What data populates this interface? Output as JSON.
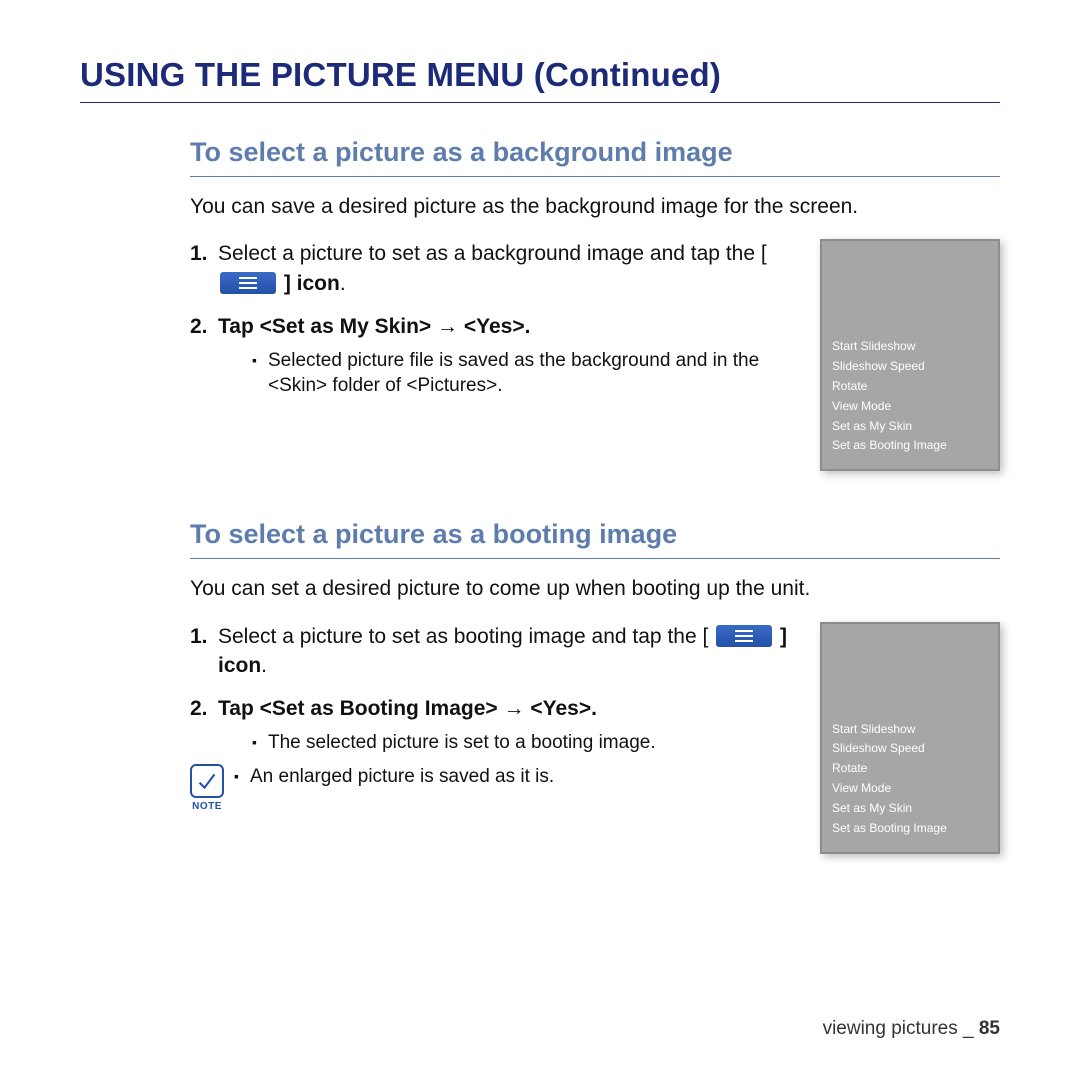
{
  "title": "USING THE PICTURE MENU (Continued)",
  "section1": {
    "heading": "To select a picture as a background image",
    "intro": "You can save a desired picture as the background image for the screen.",
    "step1_a": "Select a picture to set as a background image and tap the [ ",
    "step1_b": " ] icon",
    "step1_period": ".",
    "step2": "Tap <Set as My Skin> → <Yes>.",
    "bullet1": "Selected picture file is saved as the background and in the <Skin> folder of <Pictures>."
  },
  "section2": {
    "heading": "To select a picture as a booting image",
    "intro": "You can set a desired picture to come up when booting up the unit.",
    "step1_a": "Select a picture to set as booting image and tap the [ ",
    "step1_b": " ] icon",
    "step1_period": ".",
    "step2": "Tap <Set as Booting Image> → <Yes>.",
    "bullet1": "The selected picture is set to a booting image.",
    "note_label": "NOTE",
    "note_text": "An enlarged picture is saved as it is."
  },
  "menu_items": {
    "i0": "Start Slideshow",
    "i1": "Slideshow Speed",
    "i2": "Rotate",
    "i3": "View Mode",
    "i4": "Set as My Skin",
    "i5": "Set as Booting Image"
  },
  "footer": {
    "label": "viewing pictures _ ",
    "page": "85"
  },
  "numbers": {
    "one": "1.",
    "two": "2."
  }
}
